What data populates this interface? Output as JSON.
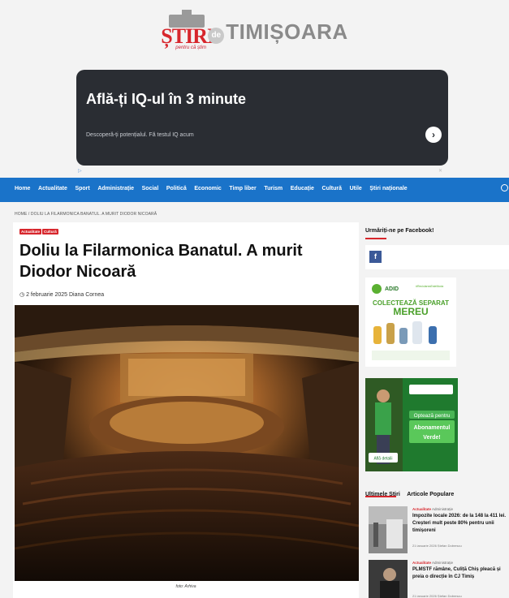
{
  "logo": {
    "stiri": "ȘTIRI",
    "de": "de",
    "word": "TIMIȘOARA",
    "tagline": "pentru că știm"
  },
  "ad": {
    "headline": "Află-ți IQ-ul în 3 minute",
    "subtext": "Descoperă-ți potențialul. Fă testul IQ acum",
    "go_icon": "›",
    "badge_left": "▷",
    "badge_right": "✕"
  },
  "nav": {
    "items": [
      "Home",
      "Actualitate",
      "Sport",
      "Administrație",
      "Social",
      "Politică",
      "Economic",
      "Timp liber",
      "Turism",
      "Educație",
      "Cultură",
      "Utile",
      "Știri naționale"
    ]
  },
  "breadcrumb": "HOME / DOLIU LA FILARMONICA BANATUL. A MURIT DIODOR NICOARĂ",
  "article": {
    "badges": [
      "Actualitate",
      "Cultură"
    ],
    "title": "Doliu la Filarmonica Banatul. A murit Diodor Nicoară",
    "date": "2 februarie 2025",
    "author": "Diana Cornea",
    "caption": "foto: Arhiva"
  },
  "sidebar": {
    "fb_heading": "Urmăriți-ne pe Facebook!",
    "fb_letter": "f",
    "adid_brand": "ADID",
    "adid_hashtag": "#ReciclareaEsteModa",
    "adid_line1": "COLECTEAZĂ SEPARAT",
    "adid_line2": "MEREU",
    "green_ad_lines": [
      "Optează pentru",
      "Abonamentul",
      "Verde!"
    ],
    "green_ad_button": "Află detalii",
    "tabs": [
      "Ultimele Știri",
      "Articole Populare"
    ],
    "news": [
      {
        "cat1": "Actualitate",
        "cat2": "Administrație",
        "title": "Impozite locale 2026: de la 148 la 411 lei. Creșteri mult peste 80% pentru unii timișoreni",
        "meta": "21 ianuarie 2026   Ștefan Dobrescu"
      },
      {
        "cat1": "Actualitate",
        "cat2": "Administrație",
        "title": "PLMSTF rămâne, Culiță Chiș pleacă și preia o direcție în CJ Timiș",
        "meta": "21 ianuarie 2026   Ștefan Dobrescu"
      }
    ]
  },
  "colors": {
    "nav": "#1a73c9",
    "accent": "#d7262c",
    "ad_bg": "#2a2d33",
    "green_ad": "#1f7a2e"
  }
}
